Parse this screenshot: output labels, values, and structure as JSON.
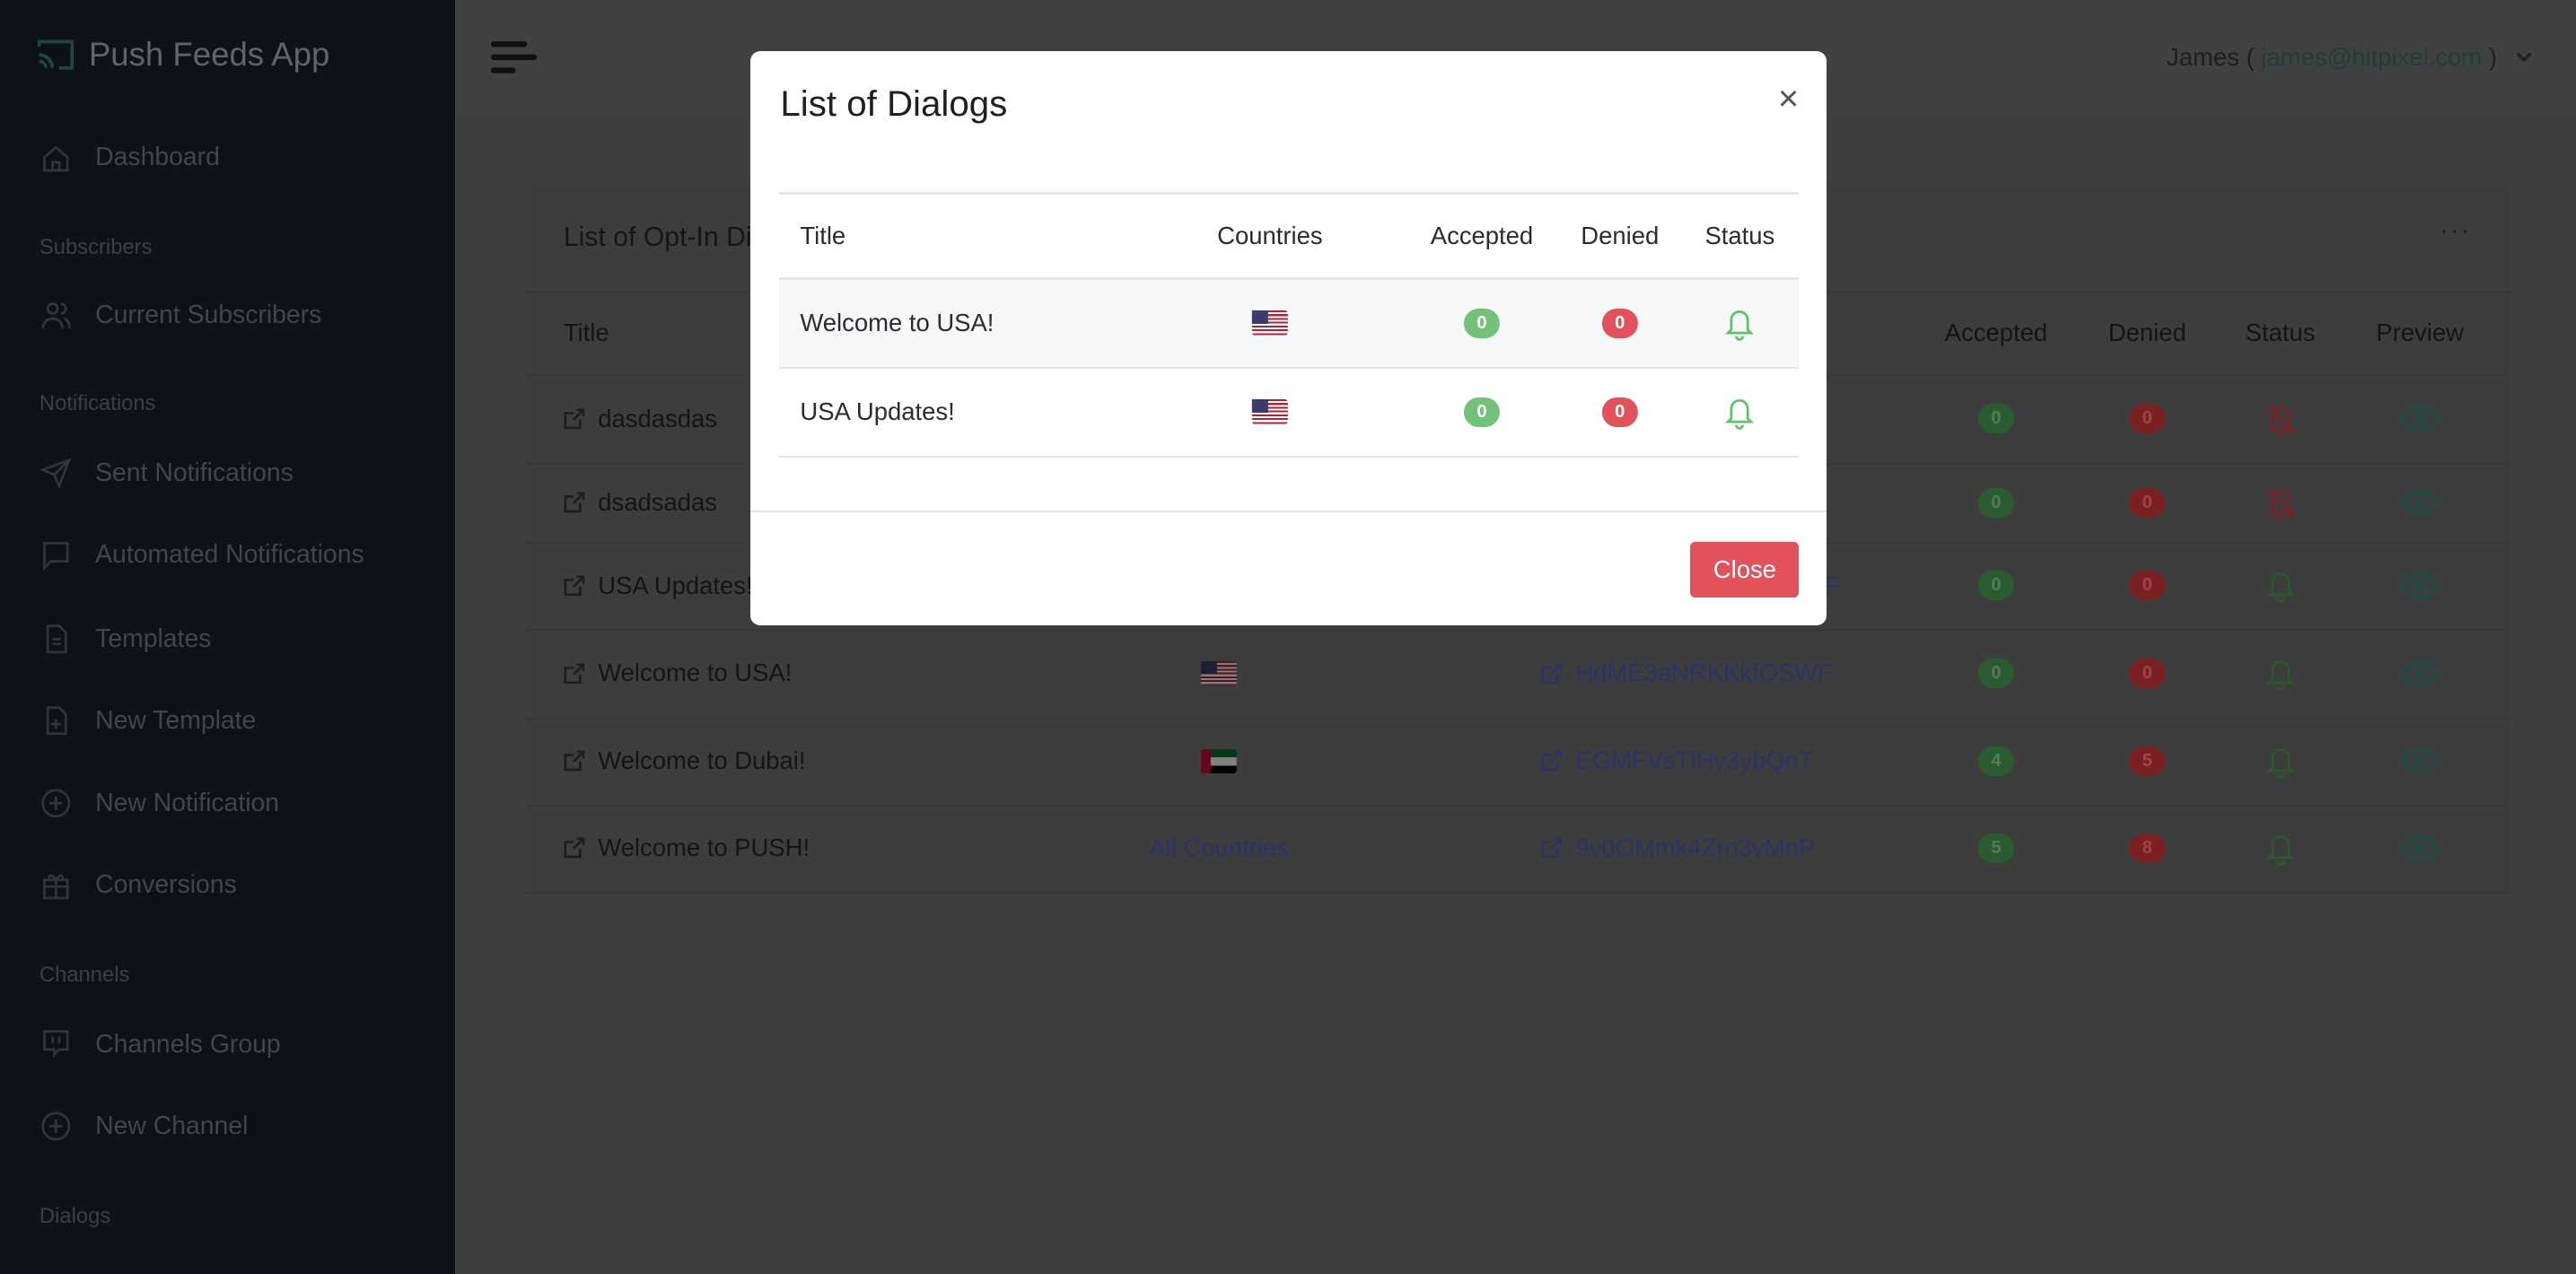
{
  "app": {
    "name": "Push Feeds App",
    "logo_icon": "cast-icon",
    "accent": "#2d6b63"
  },
  "sidebar": {
    "sections": [
      {
        "label": "",
        "items": [
          {
            "label": "Dashboard",
            "icon": "home-icon"
          }
        ]
      },
      {
        "label": "Subscribers",
        "items": [
          {
            "label": "Current Subscribers",
            "icon": "users-icon"
          }
        ]
      },
      {
        "label": "Notifications",
        "items": [
          {
            "label": "Sent Notifications",
            "icon": "send-icon"
          },
          {
            "label": "Automated Notifications",
            "icon": "message-icon"
          },
          {
            "label": "Templates",
            "icon": "file-icon"
          },
          {
            "label": "New Template",
            "icon": "file-plus-icon"
          },
          {
            "label": "New Notification",
            "icon": "plus-circle-icon"
          },
          {
            "label": "Conversions",
            "icon": "gift-icon"
          }
        ]
      },
      {
        "label": "Channels",
        "items": [
          {
            "label": "Channels Group",
            "icon": "twitch-icon"
          },
          {
            "label": "New Channel",
            "icon": "plus-circle-icon"
          }
        ]
      },
      {
        "label": "Dialogs",
        "items": []
      }
    ]
  },
  "topbar": {
    "menu_icon": "menu-icon",
    "user_name": "James (",
    "user_email": "james@hitpixel.com",
    "user_close": ")",
    "chevron": "chevron-down-icon"
  },
  "card": {
    "title": "List of Opt-In Dialogs",
    "more": "···",
    "columns": {
      "title": "Title",
      "accepted": "Accepted",
      "denied": "Denied",
      "status": "Status",
      "preview": "Preview"
    },
    "rows": [
      {
        "title": "dasdasdas",
        "flag": null,
        "country_text": null,
        "dialog_id": null,
        "accepted": "0",
        "denied": "0",
        "status": "muted"
      },
      {
        "title": "dsadsadas",
        "flag": null,
        "country_text": null,
        "dialog_id": null,
        "accepted": "0",
        "denied": "0",
        "status": "muted"
      },
      {
        "title": "USA Updates!",
        "flag": null,
        "country_text": null,
        "dialog_id": "F",
        "accepted": "0",
        "denied": "0",
        "status": "active"
      },
      {
        "title": "Welcome to USA!",
        "flag": "us",
        "country_text": null,
        "dialog_id": "HdME3aNRKKkfOSWF",
        "accepted": "0",
        "denied": "0",
        "status": "active"
      },
      {
        "title": "Welcome to Dubai!",
        "flag": "ae",
        "country_text": null,
        "dialog_id": "EGMFVsTlHy3ybQnT",
        "accepted": "4",
        "denied": "5",
        "status": "active"
      },
      {
        "title": "Welcome to PUSH!",
        "flag": null,
        "country_text": "All Countries",
        "dialog_id": "9v0OMmk4Zrn3vMnP",
        "accepted": "5",
        "denied": "8",
        "status": "active"
      }
    ]
  },
  "modal": {
    "title": "List of Dialogs",
    "close_icon": "×",
    "columns": {
      "title": "Title",
      "countries": "Countries",
      "accepted": "Accepted",
      "denied": "Denied",
      "status": "Status"
    },
    "rows": [
      {
        "title": "Welcome to USA!",
        "flag": "us",
        "accepted": "0",
        "denied": "0",
        "status": "active"
      },
      {
        "title": "USA Updates!",
        "flag": "us",
        "accepted": "0",
        "denied": "0",
        "status": "active"
      }
    ],
    "close_label": "Close",
    "colors": {
      "accepted": "#74c27a",
      "denied": "#e3525b",
      "status_active": "#5cc466"
    }
  }
}
